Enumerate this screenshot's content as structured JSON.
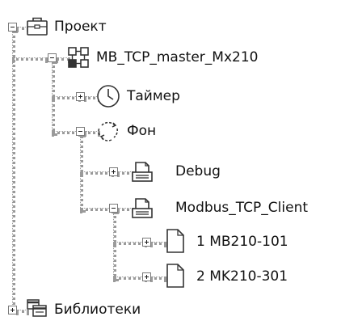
{
  "tree": {
    "project": {
      "label": "Проект",
      "icon": "briefcase-icon",
      "expanded": true
    },
    "device": {
      "label": "MB_TCP_master_Mx210",
      "icon": "network-nodes-icon",
      "expanded": true
    },
    "timer": {
      "label": "Таймер",
      "icon": "clock-icon",
      "expanded": false
    },
    "background": {
      "label": "Фон",
      "icon": "cycle-arrows-icon",
      "expanded": true
    },
    "debug": {
      "label": "Debug",
      "icon": "printer-document-icon",
      "expanded": false
    },
    "modbus_client": {
      "label": "Modbus_TCP_Client",
      "icon": "printer-document-icon",
      "expanded": true
    },
    "dev1": {
      "label": "1 MB210-101",
      "icon": "document-icon",
      "expanded": false
    },
    "dev2": {
      "label": "2 MK210-301",
      "icon": "document-icon",
      "expanded": false
    },
    "libraries": {
      "label": "Библиотеки",
      "icon": "library-windows-icon",
      "expanded": false
    }
  }
}
